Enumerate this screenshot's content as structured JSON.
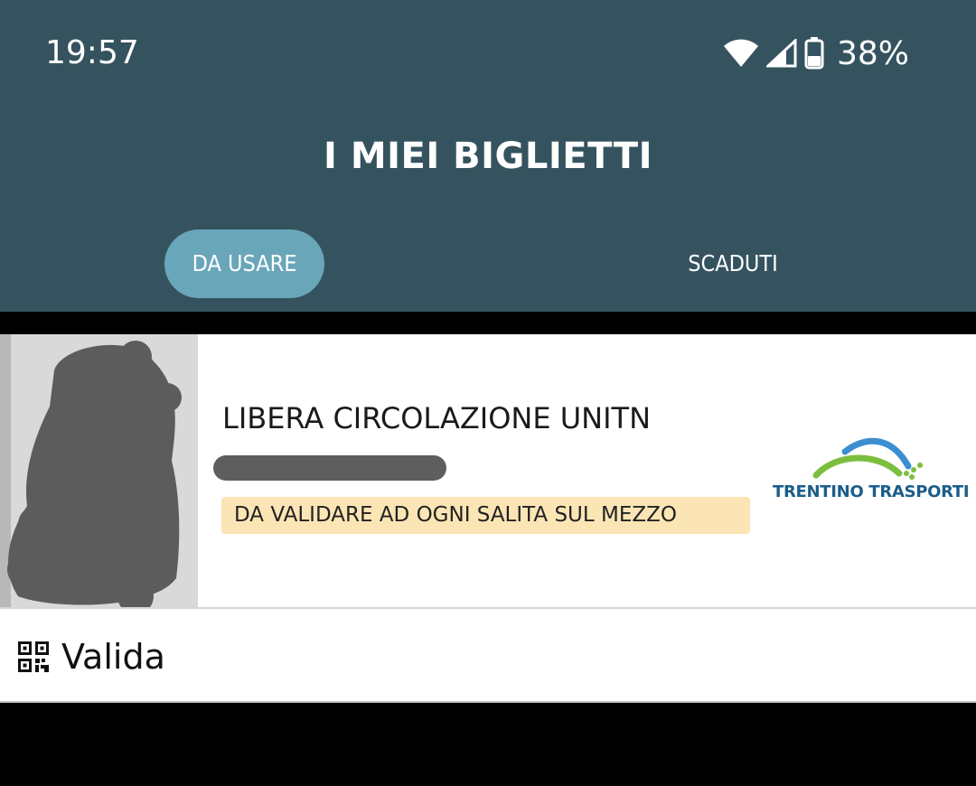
{
  "status_bar": {
    "time": "19:57",
    "battery_percent": "38%",
    "icons": [
      "wifi-icon",
      "signal-icon",
      "battery-icon"
    ]
  },
  "header": {
    "title": "I MIEI BIGLIETTI"
  },
  "tabs": [
    {
      "label": "DA USARE",
      "active": true
    },
    {
      "label": "SCADUTI",
      "active": false
    }
  ],
  "ticket": {
    "name": "LIBERA CIRCOLAZIONE UNITN",
    "notice": "DA VALIDARE AD OGNI SALITA SUL MEZZO",
    "operator": "TRENTINO TRASPORTI",
    "action_label": "Valida",
    "action_icon": "qr-code-icon"
  },
  "colors": {
    "appbar": "#35535f",
    "active_tab": "#6aa6ba",
    "notice_background": "#fce5b4",
    "logo_blue": "#3b8fd0",
    "logo_green": "#7cbf3f",
    "logo_text": "#1b5d8a"
  }
}
